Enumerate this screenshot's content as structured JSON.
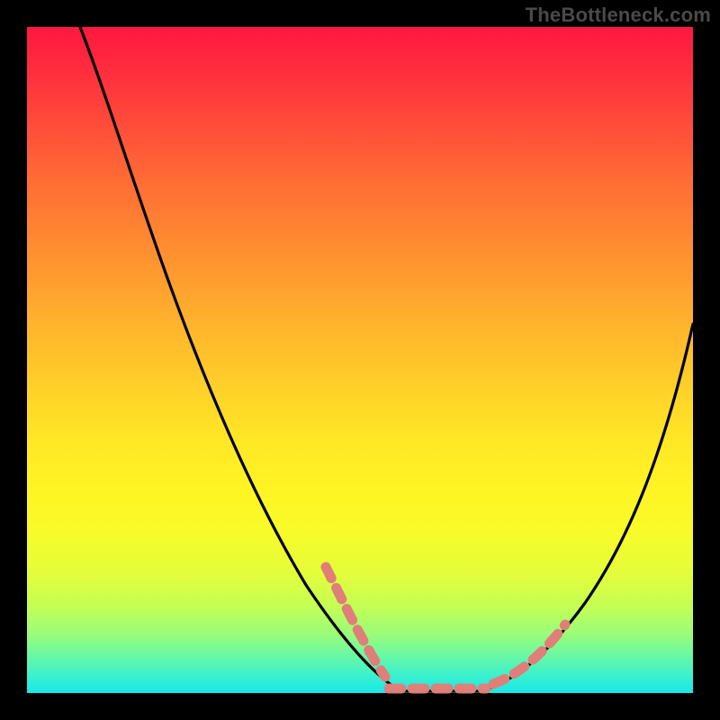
{
  "watermark": "TheBottleneck.com",
  "colors": {
    "background": "#000000",
    "curve_stroke": "#000000",
    "dotted_stroke": "#e07f79",
    "watermark_text": "#4a4a4a"
  },
  "chart_data": {
    "type": "line",
    "title": "",
    "xlabel": "",
    "ylabel": "",
    "xlim": [
      0,
      100
    ],
    "ylim": [
      0,
      100
    ],
    "grid": false,
    "series": [
      {
        "name": "bottleneck-curve-left",
        "x": [
          8,
          14,
          20,
          26,
          32,
          38,
          44,
          48,
          52,
          56
        ],
        "y": [
          100,
          85,
          70,
          56,
          42,
          29,
          17,
          9,
          3,
          0
        ]
      },
      {
        "name": "bottleneck-curve-right",
        "x": [
          68,
          72,
          76,
          80,
          84,
          88,
          92,
          96,
          100
        ],
        "y": [
          0,
          3,
          7,
          13,
          20,
          28,
          37,
          46,
          55
        ]
      },
      {
        "name": "valley-floor",
        "x": [
          56,
          58,
          60,
          62,
          64,
          66,
          68
        ],
        "y": [
          0,
          0,
          0,
          0,
          0,
          0,
          0
        ]
      }
    ],
    "dotted_segments": [
      {
        "name": "left-descent-overlay",
        "x_range": [
          44,
          52
        ],
        "approx_y_range": [
          17,
          3
        ]
      },
      {
        "name": "valley-floor-overlay",
        "x_range": [
          54,
          68
        ],
        "approx_y_range": [
          0,
          0
        ]
      },
      {
        "name": "right-ascent-overlay",
        "x_range": [
          70,
          78
        ],
        "approx_y_range": [
          2,
          10
        ]
      }
    ]
  }
}
